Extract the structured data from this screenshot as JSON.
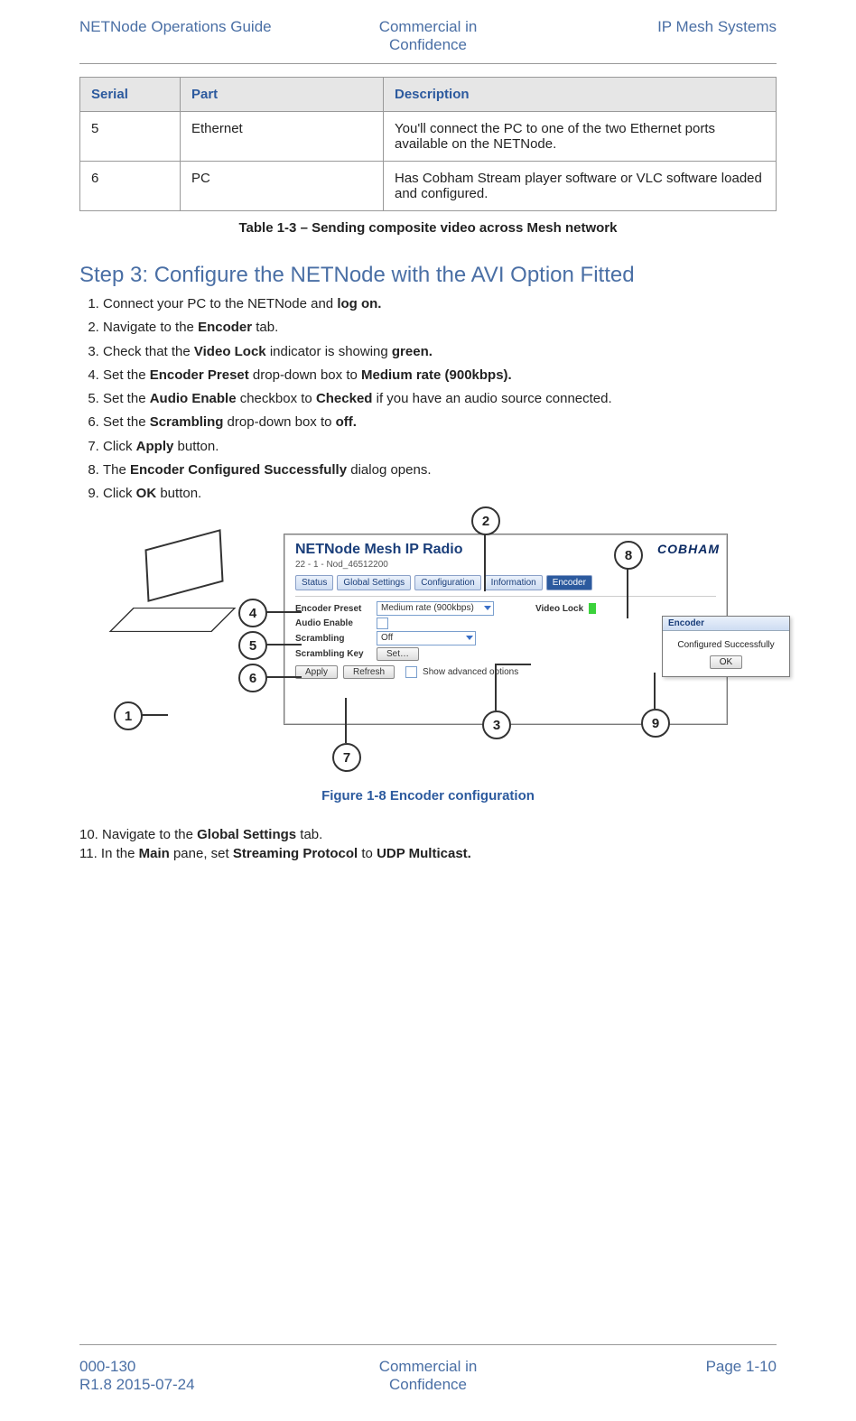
{
  "header": {
    "left": "NETNode Operations Guide",
    "center_l1": "Commercial in",
    "center_l2": "Confidence",
    "right": "IP Mesh Systems"
  },
  "table": {
    "headers": {
      "c1": "Serial",
      "c2": "Part",
      "c3": "Description"
    },
    "rows": [
      {
        "c1": "5",
        "c2": "Ethernet",
        "c3": "You'll connect the PC to one of the two Ethernet ports available on the NETNode."
      },
      {
        "c1": "6",
        "c2": "PC",
        "c3": "Has Cobham Stream player software or VLC software loaded and configured."
      }
    ],
    "caption": "Table 1-3 – Sending composite video across Mesh network"
  },
  "step_heading": "Step 3: Configure the NETNode with the AVI Option Fitted",
  "steps_a": [
    {
      "pre": "Connect your PC to the NETNode and ",
      "b1": "log on."
    },
    {
      "pre": "Navigate to the ",
      "b1": "Encoder",
      "post": " tab."
    },
    {
      "pre": "Check that the ",
      "b1": "Video Lock",
      "mid": " indicator is showing ",
      "b2": "green."
    },
    {
      "pre": "Set the ",
      "b1": "Encoder Preset",
      "mid": " drop-down box to ",
      "b2": "Medium rate (900kbps)."
    },
    {
      "pre": "Set the ",
      "b1": "Audio Enable",
      "mid": " checkbox to ",
      "b2": "Checked",
      "post": " if you have an audio source connected."
    },
    {
      "pre": "Set the ",
      "b1": "Scrambling",
      "mid": " drop-down box to ",
      "b2": "off."
    },
    {
      "pre": "Click ",
      "b1": "Apply",
      "post": " button."
    },
    {
      "pre": "The ",
      "b1": "Encoder Configured Successfully",
      "post": " dialog opens."
    },
    {
      "pre": "Click ",
      "b1": "OK",
      "post": " button."
    }
  ],
  "figure": {
    "win_title": "NETNode Mesh IP Radio",
    "win_sub": "22 - 1 - Nod_46512200",
    "tabs": [
      "Status",
      "Global Settings",
      "Configuration",
      "Information",
      "Encoder"
    ],
    "active_tab": "Encoder",
    "form": {
      "preset_label": "Encoder Preset",
      "preset_value": "Medium rate (900kbps)",
      "videolock_label": "Video Lock",
      "audio_label": "Audio Enable",
      "scrambling_label": "Scrambling",
      "scrambling_value": "Off",
      "scramkey_label": "Scrambling Key",
      "scramkey_btn": "Set…",
      "apply": "Apply",
      "refresh": "Refresh",
      "advanced": "Show advanced options"
    },
    "dialog": {
      "title": "Encoder",
      "body": "Configured Successfully",
      "ok": "OK"
    },
    "brand": "COBHAM",
    "callouts": {
      "c1": "1",
      "c2": "2",
      "c3": "3",
      "c4": "4",
      "c5": "5",
      "c6": "6",
      "c7": "7",
      "c8": "8",
      "c9": "9"
    },
    "caption": "Figure 1-8 Encoder configuration"
  },
  "steps_b": [
    {
      "n": "10.",
      "pre": "Navigate to the ",
      "b1": "Global Settings",
      "post": " tab."
    },
    {
      "n": "11.",
      "pre": "In the ",
      "b1": "Main",
      "mid": " pane, set ",
      "b2": "Streaming Protocol",
      "mid2": " to ",
      "b3": "UDP Multicast."
    }
  ],
  "footer": {
    "left_l1": "000-130",
    "left_l2": "R1.8 2015-07-24",
    "center_l1": "Commercial in",
    "center_l2": "Confidence",
    "right": "Page 1-10"
  }
}
